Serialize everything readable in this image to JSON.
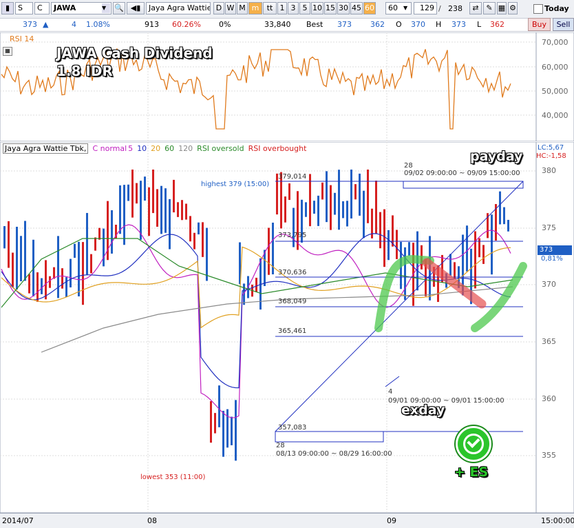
{
  "toolbar": {
    "type_code": "S",
    "market_code": "C",
    "ticker": "JAWA",
    "company_name_short": "Jaya Agra Wattie",
    "periods": [
      "D",
      "W",
      "M",
      "m",
      "tt",
      "1",
      "3",
      "5",
      "10",
      "15",
      "30",
      "45",
      "60"
    ],
    "selected_period": "60",
    "interval_value": "60",
    "bar_count": "129",
    "total_count": "238",
    "today_label": "Today"
  },
  "quote": {
    "last": "373",
    "change": "4",
    "change_pct": "1.08%",
    "volume": "913",
    "vol_pct": "60.26%",
    "pct0": "0%",
    "value": "33,840",
    "best_label": "Best",
    "best_bid": "373",
    "best_ask": "362",
    "o_label": "O",
    "open": "370",
    "h_label": "H",
    "high": "373",
    "l_label": "L",
    "low": "362",
    "buy_label": "Buy",
    "sell_label": "Sell"
  },
  "rsi_panel": {
    "title": "RSI 14",
    "ticks": [
      "70,000",
      "60,000",
      "50,000",
      "40,000"
    ],
    "color": "#e07a1c"
  },
  "main_panel": {
    "legend_name": "Jaya Agra Wattie Tbk,",
    "legend_items": [
      "C normal",
      "5",
      "10",
      "20",
      "60",
      "120"
    ],
    "rsi_oversold": "RSI oversold",
    "rsi_overbought": "RSI overbought",
    "lc_label": "LC:5,67",
    "hc_label": "HC:-1,58",
    "price_ticks": [
      "380",
      "375",
      "370",
      "365",
      "360",
      "355"
    ],
    "current_price": "373",
    "current_pct": "0,81%",
    "highest_label": "highest 379 (15:00)",
    "lowest_label": "lowest 353 (11:00)",
    "fib_levels": [
      "379,014",
      "373,795",
      "370,636",
      "368,049",
      "365,461",
      "357,083"
    ],
    "box1_count": "28",
    "box1_range": "09/02 09:00:00 ~ 09/09 15:00:00",
    "box2_count": "28",
    "box2_range": "08/13 09:00:00 ~ 08/29 16:00:00",
    "box3_count": "4",
    "box3_range": "09/01 09:00:00 ~ 09/01 15:00:00",
    "colors": {
      "up": "#1f5fc4",
      "down": "#d62020",
      "ma5": "#c020c0",
      "ma10": "#2030c0",
      "ma20": "#e0a020",
      "ma60": "#2a8a2a",
      "ma120": "#8a8a8a"
    }
  },
  "annotations": {
    "title_line1": "JAWA Cash Dividend",
    "title_line2": "1.8 IDR",
    "payday": "payday",
    "exday": "exday",
    "es_label": "+ ES"
  },
  "x_axis": {
    "labels": [
      "2014/07",
      "08",
      "09",
      "15:00:00"
    ]
  }
}
